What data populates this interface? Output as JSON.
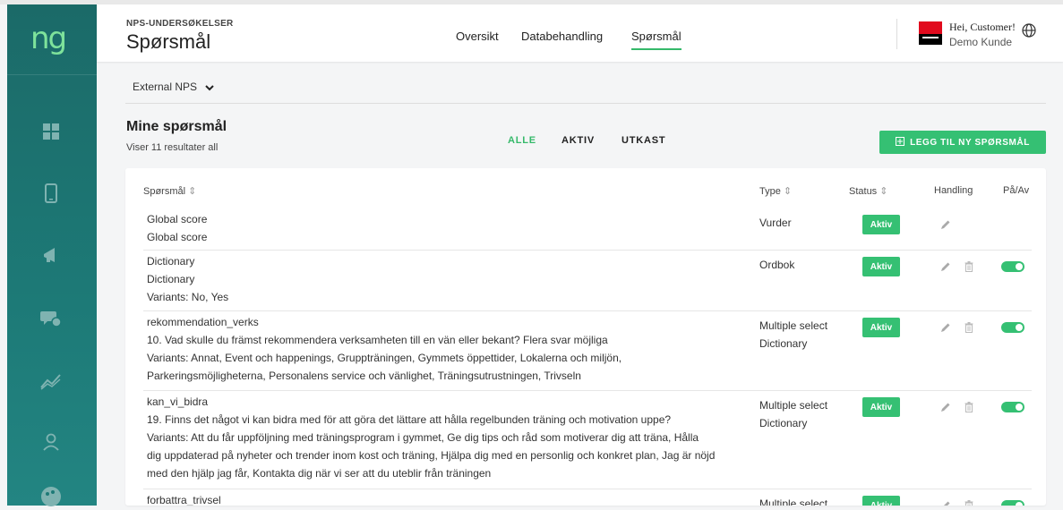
{
  "sidebar": {
    "logo": "ng",
    "icons": [
      "dashboard-icon",
      "mobile-icon",
      "megaphone-icon",
      "chat-check-icon",
      "trend-icon",
      "user-icon",
      "palette-icon"
    ]
  },
  "header": {
    "kicker": "NPS-UNDERSØKELSER",
    "title": "Spørsmål",
    "nav": [
      "Oversikt",
      "Databehandling",
      "Spørsmål"
    ],
    "active_nav": "Spørsmål",
    "greeting": "Hei, Customer!",
    "customer_name": "Demo Kunde"
  },
  "selector": {
    "label": "External NPS"
  },
  "section": {
    "title": "Mine spørsmål",
    "count_text": "Viser 11 resultater all",
    "filters": [
      "ALLE",
      "AKTIV",
      "UTKAST"
    ],
    "active_filter": "ALLE",
    "add_button": "LEGG TIL NY SPØRSMÅL"
  },
  "table": {
    "columns": {
      "question": "Spørsmål",
      "type": "Type",
      "status": "Status",
      "action": "Handling",
      "toggle": "På/Av"
    },
    "rows": [
      {
        "lines": [
          "Global score",
          "Global score"
        ],
        "type": [
          "Vurder"
        ],
        "status": "Aktiv",
        "deletable": false,
        "toggle": false
      },
      {
        "lines": [
          "Dictionary",
          "Dictionary",
          "Variants: No, Yes"
        ],
        "type": [
          "Ordbok"
        ],
        "status": "Aktiv",
        "deletable": true,
        "toggle": true
      },
      {
        "lines": [
          "rekommendation_verks",
          "10. Vad skulle du främst rekommendera verksamheten till en vän eller bekant? Flera svar möjliga",
          "Variants: Annat, Event och happenings, Gruppträningen, Gymmets öppettider, Lokalerna och miljön,",
          "Parkeringsmöjligheterna, Personalens service och vänlighet, Träningsutrustningen, Trivseln"
        ],
        "type": [
          "Multiple select",
          "Dictionary"
        ],
        "status": "Aktiv",
        "deletable": true,
        "toggle": true
      },
      {
        "lines": [
          "kan_vi_bidra",
          "19. Finns det något vi kan bidra med för att göra det lättare att hålla regelbunden träning och motivation uppe?",
          "Variants: Att du får uppföljning med träningsprogram i gymmet, Ge dig tips och råd som motiverar dig att träna, Hålla",
          "dig uppdaterad på nyheter och trender inom kost och träning, Hjälpa dig med en personlig och konkret plan, Jag är nöjd",
          "med den hjälp jag får, Kontakta dig när vi ser att du uteblir från träningen"
        ],
        "type": [
          "Multiple select",
          "Dictionary"
        ],
        "status": "Aktiv",
        "deletable": true,
        "toggle": true
      },
      {
        "lines": [
          "forbattra_trivsel"
        ],
        "type": [
          "Multiple select"
        ],
        "status": "Aktiv",
        "deletable": true,
        "toggle": true
      }
    ]
  },
  "colors": {
    "accent": "#35c073",
    "sidebar": "#1d7a77",
    "logo": "#7ee29b"
  }
}
